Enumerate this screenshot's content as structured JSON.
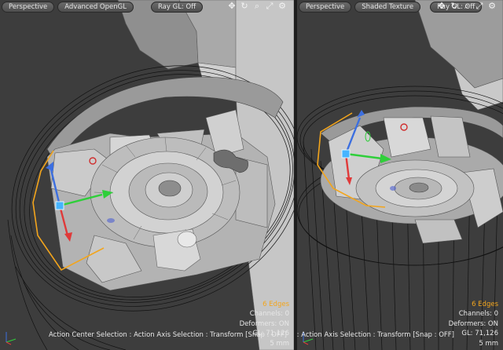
{
  "viewports": [
    {
      "view_label": "Perspective",
      "shading_label": "Advanced OpenGL",
      "raygl_label": "Ray GL: Off",
      "stats": {
        "selection": "6 Edges",
        "channels": "Channels: 0",
        "deformers": "Deformers: ON",
        "gl": "GL: 71,126",
        "size": "5 mm"
      },
      "status_text": "Action Center Selection : Action Axis Selection : Transform [Snap : OFF]"
    },
    {
      "view_label": "Perspective",
      "shading_label": "Shaded Texture",
      "raygl_label": "Ray GL: Off",
      "stats": {
        "selection": "6 Edges",
        "channels": "Channels: 0",
        "deformers": "Deformers: ON",
        "gl": "GL: 71,126",
        "size": "5 mm"
      },
      "status_text": "Action Center Selection : Action Axis Selection : Transform [Snap : OFF]"
    }
  ],
  "icons": {
    "move": "move-view-icon",
    "rotate": "rotate-view-icon",
    "zoom": "zoom-view-icon",
    "maximize": "maximize-view-icon",
    "options": "viewport-options-icon"
  },
  "colors": {
    "selected_edges": "#f3a51c",
    "axis_x": "#2fcf3a",
    "axis_y": "#3c6fe0",
    "axis_z": "#e03a3a",
    "viewport_bg": "#3d3d3d"
  }
}
